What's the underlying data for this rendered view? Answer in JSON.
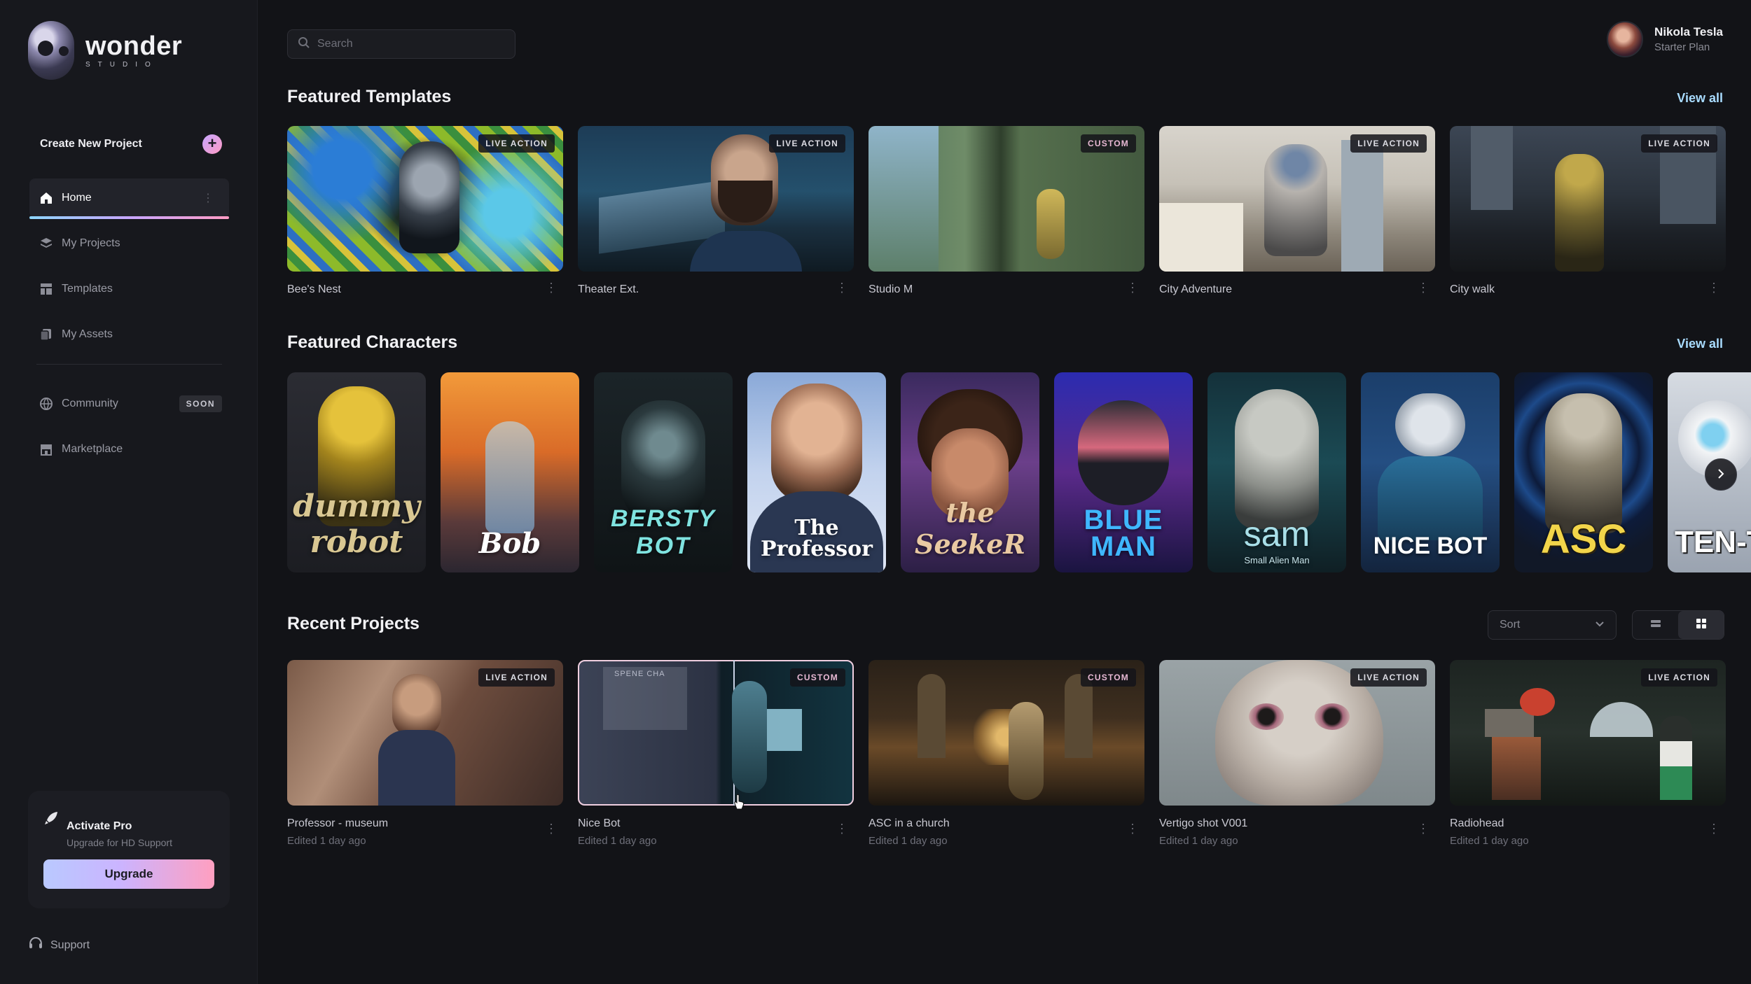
{
  "brand": {
    "name": "wonder",
    "sub": "STUDIO"
  },
  "sidebar": {
    "create_label": "Create New Project",
    "items": [
      {
        "label": "Home",
        "icon": "home-icon",
        "active": true
      },
      {
        "label": "My Projects",
        "icon": "layers-icon"
      },
      {
        "label": "Templates",
        "icon": "templates-icon"
      },
      {
        "label": "My Assets",
        "icon": "assets-icon"
      }
    ],
    "items2": [
      {
        "label": "Community",
        "icon": "globe-icon",
        "badge": "SOON"
      },
      {
        "label": "Marketplace",
        "icon": "store-icon"
      }
    ],
    "pro": {
      "title": "Activate Pro",
      "subtitle": "Upgrade for HD Support",
      "button": "Upgrade"
    },
    "support": "Support"
  },
  "search": {
    "placeholder": "Search"
  },
  "user": {
    "name": "Nikola Tesla",
    "plan": "Starter Plan"
  },
  "featured_templates": {
    "title": "Featured Templates",
    "view_all": "View all",
    "items": [
      {
        "title": "Bee's Nest",
        "badge": "LIVE ACTION"
      },
      {
        "title": "Theater Ext.",
        "badge": "LIVE ACTION"
      },
      {
        "title": "Studio M",
        "badge": "CUSTOM"
      },
      {
        "title": "City Adventure",
        "badge": "LIVE ACTION"
      },
      {
        "title": "City walk",
        "badge": "LIVE ACTION"
      }
    ]
  },
  "featured_characters": {
    "title": "Featured Characters",
    "view_all": "View all",
    "items": [
      {
        "name": "dummy robot"
      },
      {
        "name": "Bob"
      },
      {
        "name": "BERSTY BOT"
      },
      {
        "name": "The Professor"
      },
      {
        "name": "the SeekeR"
      },
      {
        "name": "BLUE MAN"
      },
      {
        "name": "sam",
        "sub": "Small Alien Man"
      },
      {
        "name": "NICE BOT"
      },
      {
        "name": "ASC"
      },
      {
        "name": "TEN-T"
      }
    ]
  },
  "recent_projects": {
    "title": "Recent Projects",
    "sort_label": "Sort",
    "items": [
      {
        "title": "Professor - museum",
        "edited": "Edited 1 day ago",
        "badge": "LIVE ACTION"
      },
      {
        "title": "Nice Bot",
        "edited": "Edited 1 day ago",
        "badge": "CUSTOM",
        "overlay_text": "SPENE CHA"
      },
      {
        "title": "ASC in a church",
        "edited": "Edited 1 day ago",
        "badge": "CUSTOM"
      },
      {
        "title": "Vertigo shot V001",
        "edited": "Edited 1 day ago",
        "badge": "LIVE ACTION"
      },
      {
        "title": "Radiohead",
        "edited": "Edited 1 day ago",
        "badge": "LIVE ACTION"
      }
    ]
  },
  "colors": {
    "background": "#121317",
    "sidebar": "#17181d",
    "accent_link": "#a9dcff",
    "upgrade_gradient_start": "#b9c9ff",
    "upgrade_gradient_end": "#ff9fc0"
  }
}
